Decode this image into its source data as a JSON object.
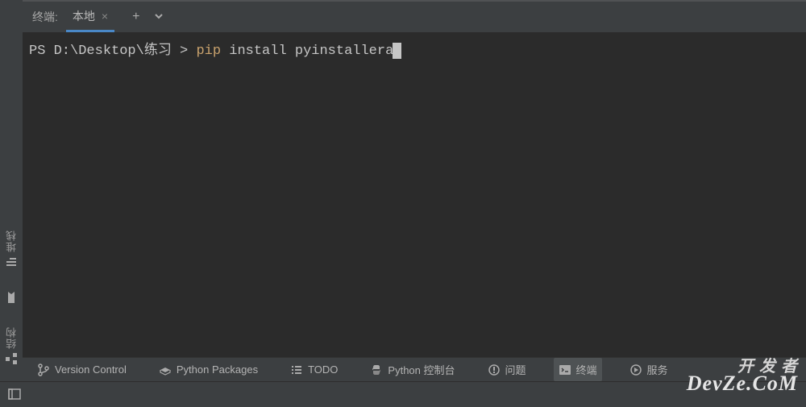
{
  "header": {
    "panel_label": "终端:",
    "tab": {
      "label": "本地"
    }
  },
  "terminal": {
    "prompt": "PS D:\\Desktop\\练习",
    "prompt_sep": ">",
    "cmd_word1": "pip",
    "cmd_rest": " install pyinstallera"
  },
  "gutter": {
    "stacks_label": "堆栈",
    "structure_label": "结构"
  },
  "toolbar": {
    "version_control": "Version Control",
    "python_packages": "Python Packages",
    "todo": "TODO",
    "python_console": "Python 控制台",
    "problems": "问题",
    "terminal": "终端",
    "services": "服务"
  },
  "watermark": {
    "line1": "开 发 者",
    "line2": "DevZe.CoM"
  }
}
